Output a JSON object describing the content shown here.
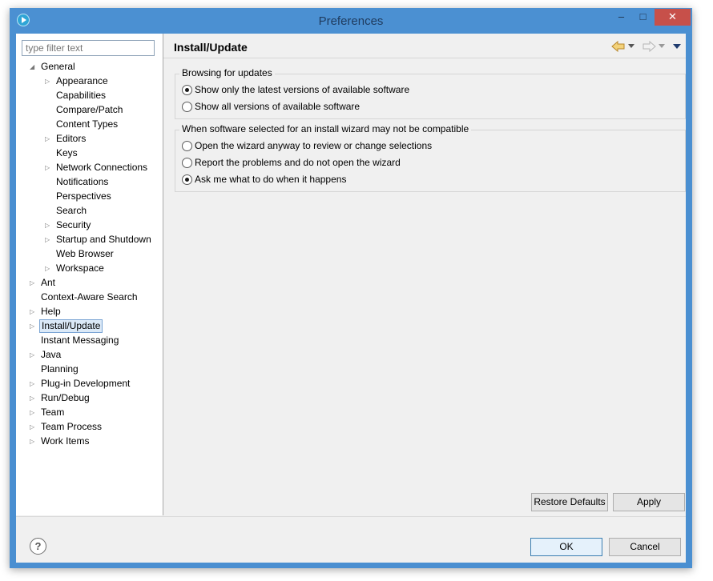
{
  "window": {
    "title": "Preferences",
    "minimize_glyph": "‒",
    "maximize_glyph": "□",
    "close_glyph": "✕"
  },
  "filter": {
    "placeholder": "type filter text"
  },
  "tree": {
    "items": [
      {
        "label": "General",
        "level": 0,
        "expander": "expanded"
      },
      {
        "label": "Appearance",
        "level": 1,
        "expander": "collapsed"
      },
      {
        "label": "Capabilities",
        "level": 1,
        "expander": "none"
      },
      {
        "label": "Compare/Patch",
        "level": 1,
        "expander": "none"
      },
      {
        "label": "Content Types",
        "level": 1,
        "expander": "none"
      },
      {
        "label": "Editors",
        "level": 1,
        "expander": "collapsed"
      },
      {
        "label": "Keys",
        "level": 1,
        "expander": "none"
      },
      {
        "label": "Network Connections",
        "level": 1,
        "expander": "collapsed"
      },
      {
        "label": "Notifications",
        "level": 1,
        "expander": "none"
      },
      {
        "label": "Perspectives",
        "level": 1,
        "expander": "none"
      },
      {
        "label": "Search",
        "level": 1,
        "expander": "none"
      },
      {
        "label": "Security",
        "level": 1,
        "expander": "collapsed"
      },
      {
        "label": "Startup and Shutdown",
        "level": 1,
        "expander": "collapsed"
      },
      {
        "label": "Web Browser",
        "level": 1,
        "expander": "none"
      },
      {
        "label": "Workspace",
        "level": 1,
        "expander": "collapsed"
      },
      {
        "label": "Ant",
        "level": 0,
        "expander": "collapsed"
      },
      {
        "label": "Context-Aware Search",
        "level": 0,
        "expander": "none"
      },
      {
        "label": "Help",
        "level": 0,
        "expander": "collapsed"
      },
      {
        "label": "Install/Update",
        "level": 0,
        "expander": "collapsed",
        "selected": true
      },
      {
        "label": "Instant Messaging",
        "level": 0,
        "expander": "none"
      },
      {
        "label": "Java",
        "level": 0,
        "expander": "collapsed"
      },
      {
        "label": "Planning",
        "level": 0,
        "expander": "none"
      },
      {
        "label": "Plug-in Development",
        "level": 0,
        "expander": "collapsed"
      },
      {
        "label": "Run/Debug",
        "level": 0,
        "expander": "collapsed"
      },
      {
        "label": "Team",
        "level": 0,
        "expander": "collapsed"
      },
      {
        "label": "Team Process",
        "level": 0,
        "expander": "collapsed"
      },
      {
        "label": "Work Items",
        "level": 0,
        "expander": "collapsed"
      }
    ]
  },
  "page": {
    "title": "Install/Update",
    "groups": [
      {
        "title": "Browsing for updates",
        "options": [
          {
            "label": "Show only the latest versions of available software",
            "checked": true
          },
          {
            "label": "Show all versions of available software",
            "checked": false
          }
        ]
      },
      {
        "title": "When software selected for an install wizard may not be compatible",
        "options": [
          {
            "label": "Open the wizard anyway to review or change selections",
            "checked": false
          },
          {
            "label": "Report the problems and do not open the wizard",
            "checked": false
          },
          {
            "label": "Ask me what to do when it happens",
            "checked": true
          }
        ]
      }
    ],
    "restore_defaults_label": "Restore Defaults",
    "apply_label": "Apply"
  },
  "footer": {
    "help_glyph": "?",
    "ok_label": "OK",
    "cancel_label": "Cancel"
  },
  "colors": {
    "title_bar": "#4b90d2",
    "close_button": "#c7504a",
    "selection_bg": "#dbe9f7",
    "selection_border": "#7aa4d4",
    "nav_back_arrow": "#e8b44a"
  }
}
